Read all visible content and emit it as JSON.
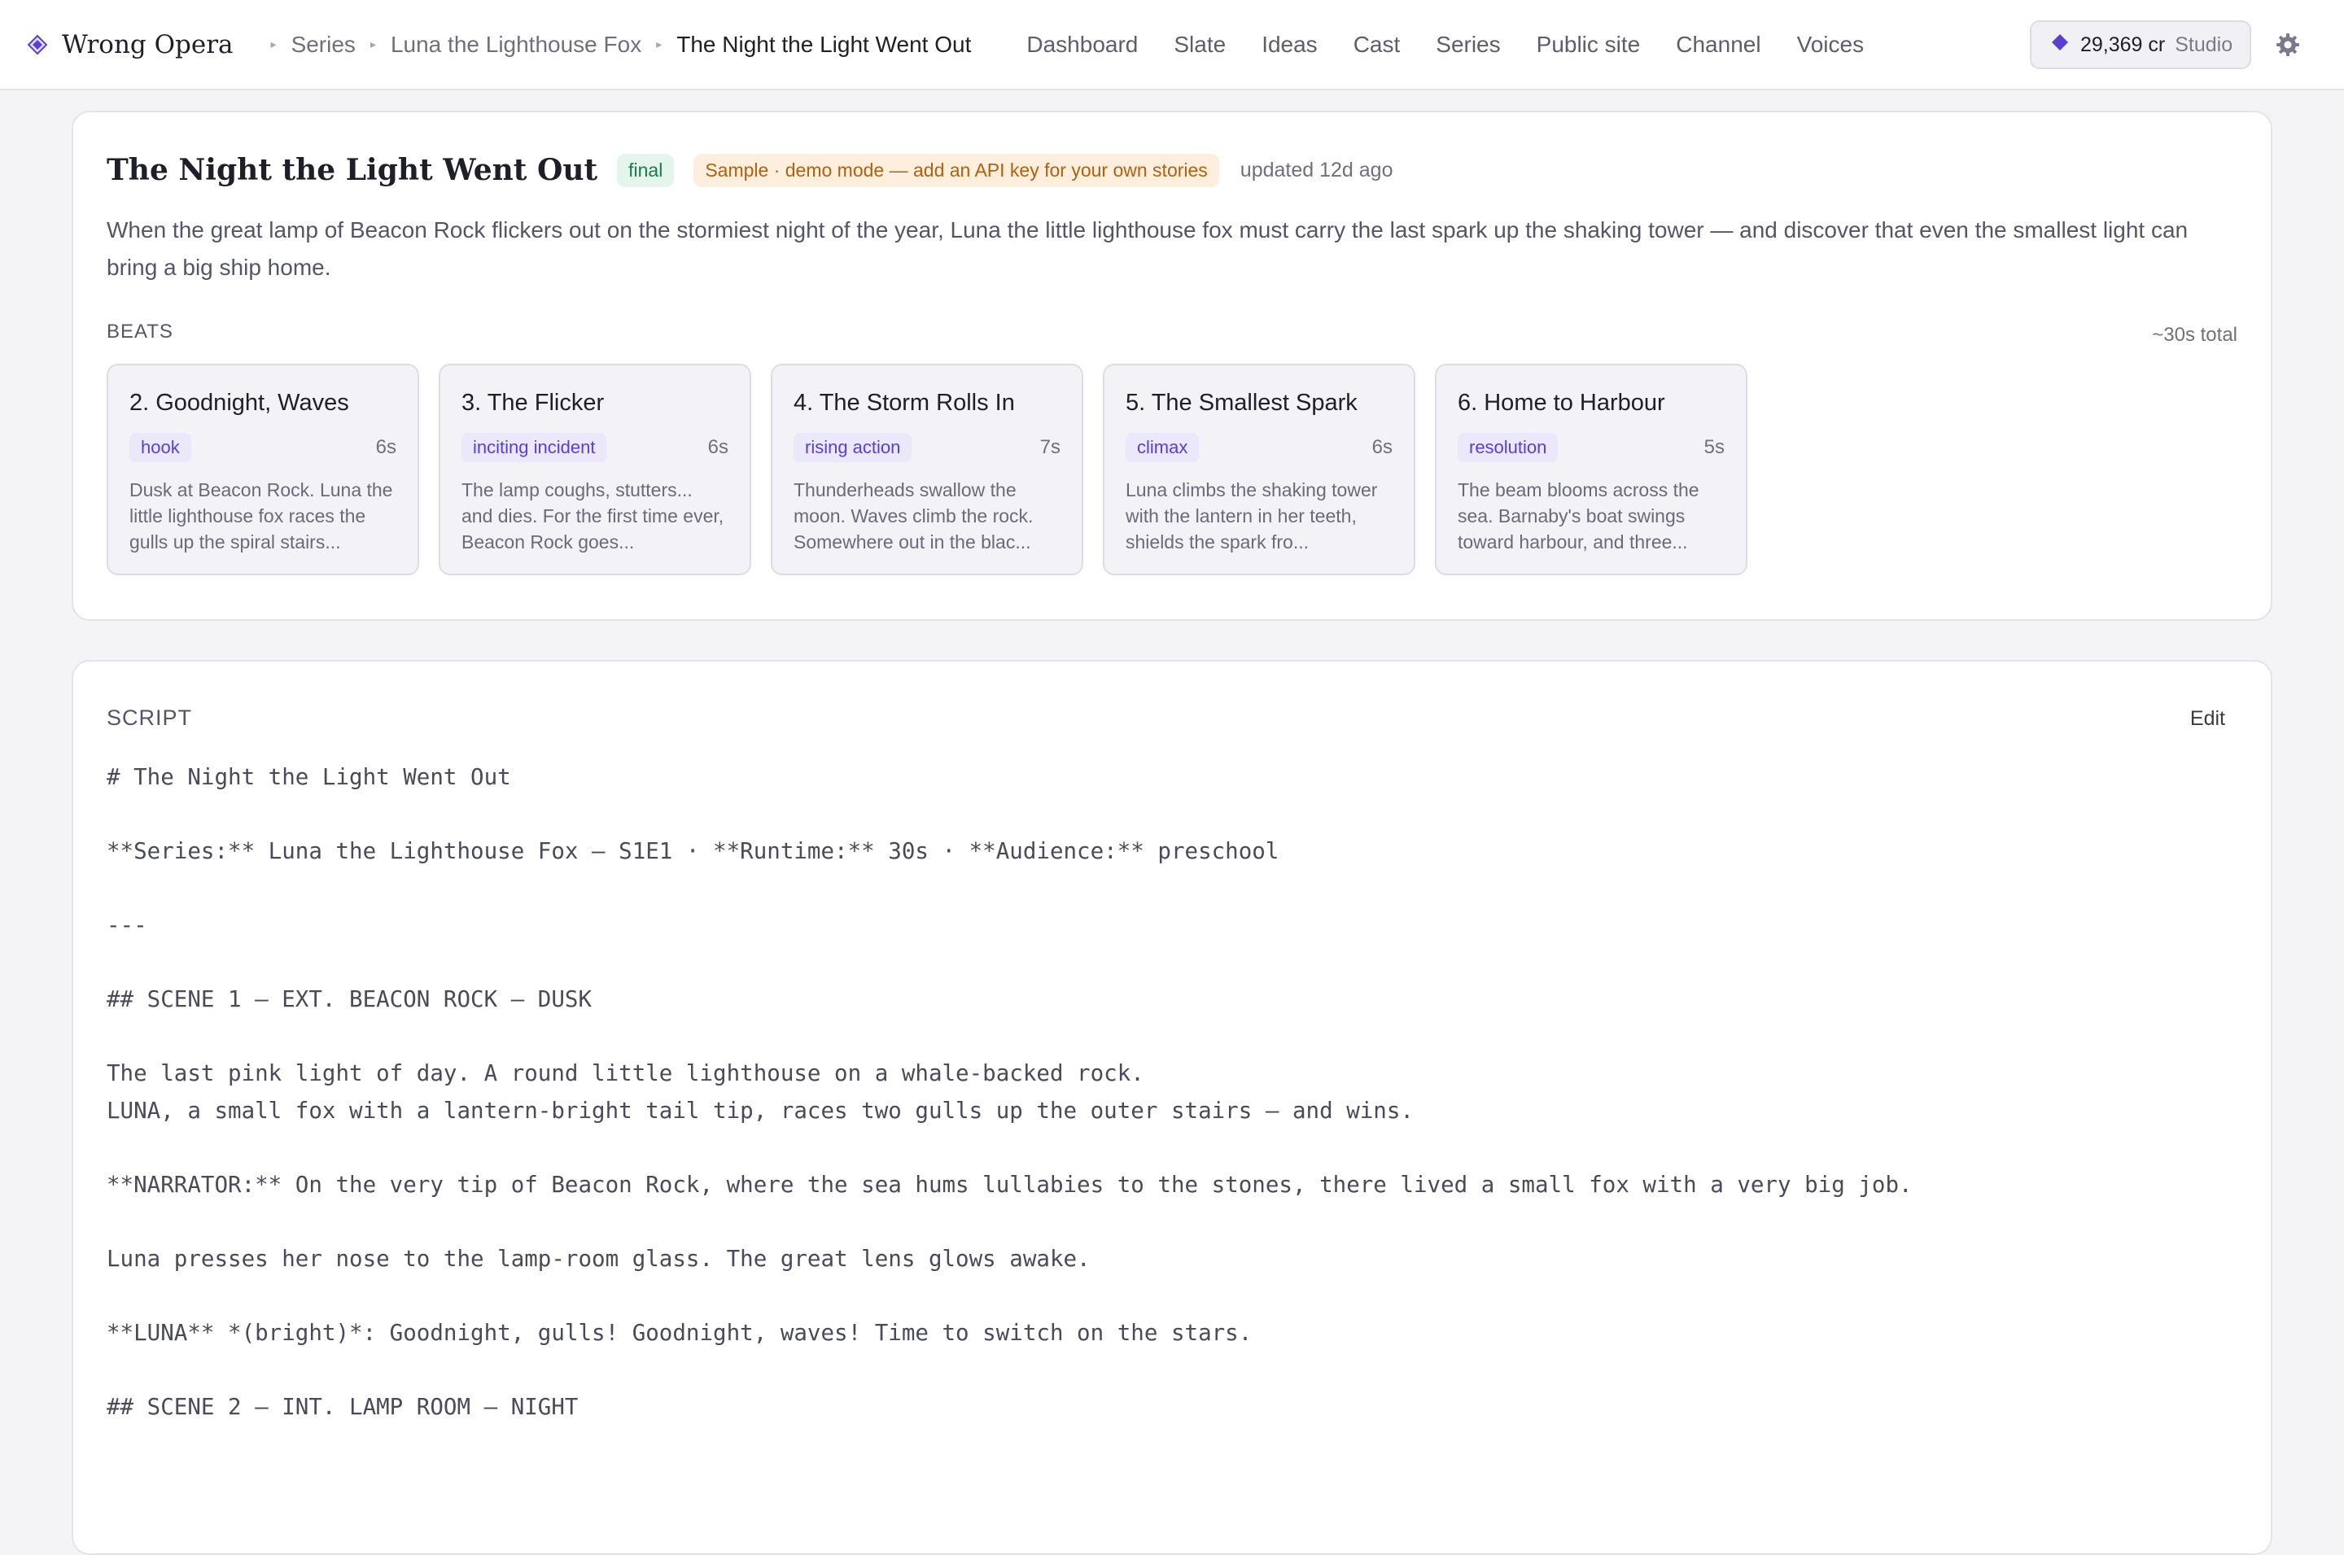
{
  "app": {
    "name": "Wrong Opera"
  },
  "breadcrumb": [
    "Series",
    "Luna the Lighthouse Fox",
    "The Night the Light Went Out"
  ],
  "nav": [
    "Dashboard",
    "Slate",
    "Ideas",
    "Cast",
    "Series",
    "Public site",
    "Channel",
    "Voices"
  ],
  "credits": {
    "amount": "29,369 cr",
    "plan": "Studio"
  },
  "colors": {
    "accent": "#5b3fd0",
    "final_bg": "#e4f5ec",
    "sample_bg": "#fdeedd"
  },
  "story": {
    "title": "The Night the Light Went Out",
    "status": "final",
    "sample_note": "Sample · demo mode — add an API key for your own stories",
    "updated": "updated 12d ago",
    "description": "When the great lamp of Beacon Rock flickers out on the stormiest night of the year, Luna the little lighthouse fox must carry the last spark up the shaking tower — and discover that even the smallest light can bring a big ship home."
  },
  "beats": {
    "label": "BEATS",
    "total": "~30s total",
    "items": [
      {
        "title": "2. Goodnight, Waves",
        "tag": "hook",
        "duration": "6s",
        "text": "Dusk at Beacon Rock. Luna the little lighthouse fox races the gulls up the spiral stairs..."
      },
      {
        "title": "3. The Flicker",
        "tag": "inciting incident",
        "duration": "6s",
        "text": "The lamp coughs, stutters... and dies. For the first time ever, Beacon Rock goes..."
      },
      {
        "title": "4. The Storm Rolls In",
        "tag": "rising action",
        "duration": "7s",
        "text": "Thunderheads swallow the moon. Waves climb the rock. Somewhere out in the blac..."
      },
      {
        "title": "5. The Smallest Spark",
        "tag": "climax",
        "duration": "6s",
        "text": "Luna climbs the shaking tower with the lantern in her teeth, shields the spark fro..."
      },
      {
        "title": "6. Home to Harbour",
        "tag": "resolution",
        "duration": "5s",
        "text": "The beam blooms across the sea. Barnaby's boat swings toward harbour, and three..."
      }
    ]
  },
  "script": {
    "label": "SCRIPT",
    "edit_label": "Edit",
    "lines": [
      "# The Night the Light Went Out",
      "",
      "**Series:** Luna the Lighthouse Fox — S1E1 · **Runtime:** 30s · **Audience:** preschool",
      "",
      "---",
      "",
      "## SCENE 1 — EXT. BEACON ROCK — DUSK",
      "",
      "The last pink light of day. A round little lighthouse on a whale-backed rock.",
      "LUNA, a small fox with a lantern-bright tail tip, races two gulls up the outer stairs — and wins.",
      "",
      "**NARRATOR:** On the very tip of Beacon Rock, where the sea hums lullabies to the stones, there lived a small fox with a very big job.",
      "",
      "Luna presses her nose to the lamp-room glass. The great lens glows awake.",
      "",
      "**LUNA** *(bright)*: Goodnight, gulls! Goodnight, waves! Time to switch on the stars.",
      "",
      "## SCENE 2 — INT. LAMP ROOM — NIGHT"
    ]
  }
}
